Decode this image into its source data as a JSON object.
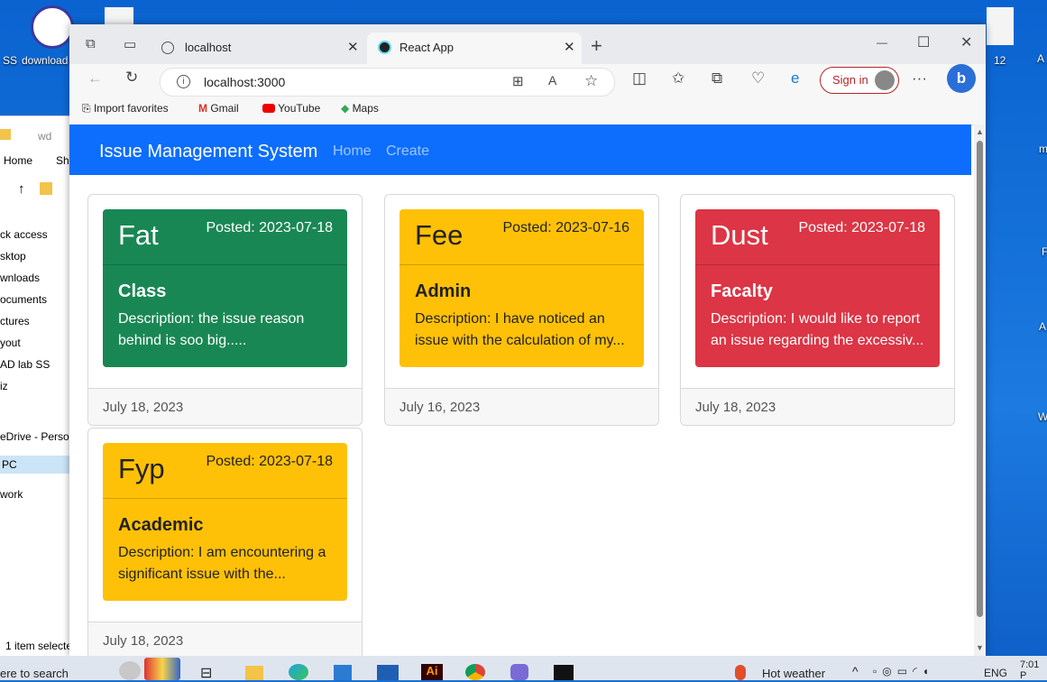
{
  "desktop": {
    "icons": [
      {
        "label": "SS"
      },
      {
        "label": "download"
      },
      {
        "label": "12"
      },
      {
        "label": "A"
      }
    ],
    "right_edge": [
      "m",
      "F",
      "A",
      "W"
    ]
  },
  "explorer": {
    "search_hint": "wd",
    "tabs": [
      "Home",
      "Sh"
    ],
    "nav_items": [
      "ck access",
      "sktop",
      "wnloads",
      "ocuments",
      "ctures",
      "yout",
      "AD lab SS",
      "iz",
      "eDrive - Persona",
      "PC",
      "work"
    ],
    "status": "1 item selecte"
  },
  "browser": {
    "tabs": [
      {
        "title": "localhost",
        "close": "✕"
      },
      {
        "title": "React App",
        "close": "✕"
      }
    ],
    "new_tab": "+",
    "window_controls": [
      "—",
      "☐",
      "✕"
    ],
    "address": "localhost:3000",
    "sign_in": "Sign in",
    "more": "···",
    "favorites": [
      {
        "label": "Import favorites"
      },
      {
        "label": "Gmail"
      },
      {
        "label": "YouTube"
      },
      {
        "label": "Maps"
      }
    ]
  },
  "app": {
    "brand": "Issue Management System",
    "nav": [
      "Home",
      "Create"
    ],
    "cards": [
      {
        "title": "Fat",
        "posted": "Posted: 2023-07-18",
        "category": "Class",
        "description": "Description: the issue reason behind is soo big.....",
        "footer": "July 18, 2023",
        "variant": "success",
        "color": "#198754"
      },
      {
        "title": "Fee",
        "posted": "Posted: 2023-07-16",
        "category": "Admin",
        "description": "Description: I have noticed an issue with the calculation of my...",
        "footer": "July 16, 2023",
        "variant": "warning",
        "color": "#ffc107"
      },
      {
        "title": "Dust",
        "posted": "Posted: 2023-07-18",
        "category": "Facalty",
        "description": "Description: I would like to report an issue regarding the excessiv...",
        "footer": "July 18, 2023",
        "variant": "danger",
        "color": "#dc3545"
      },
      {
        "title": "Fyp",
        "posted": "Posted: 2023-07-18",
        "category": "Academic",
        "description": "Description: I am encountering a significant issue with the...",
        "footer": "July 18, 2023",
        "variant": "warning",
        "color": "#ffc107"
      }
    ]
  },
  "taskbar": {
    "search": "ere to search",
    "weather": "Hot weather",
    "lang": "ENG",
    "time": "7:01 P"
  }
}
